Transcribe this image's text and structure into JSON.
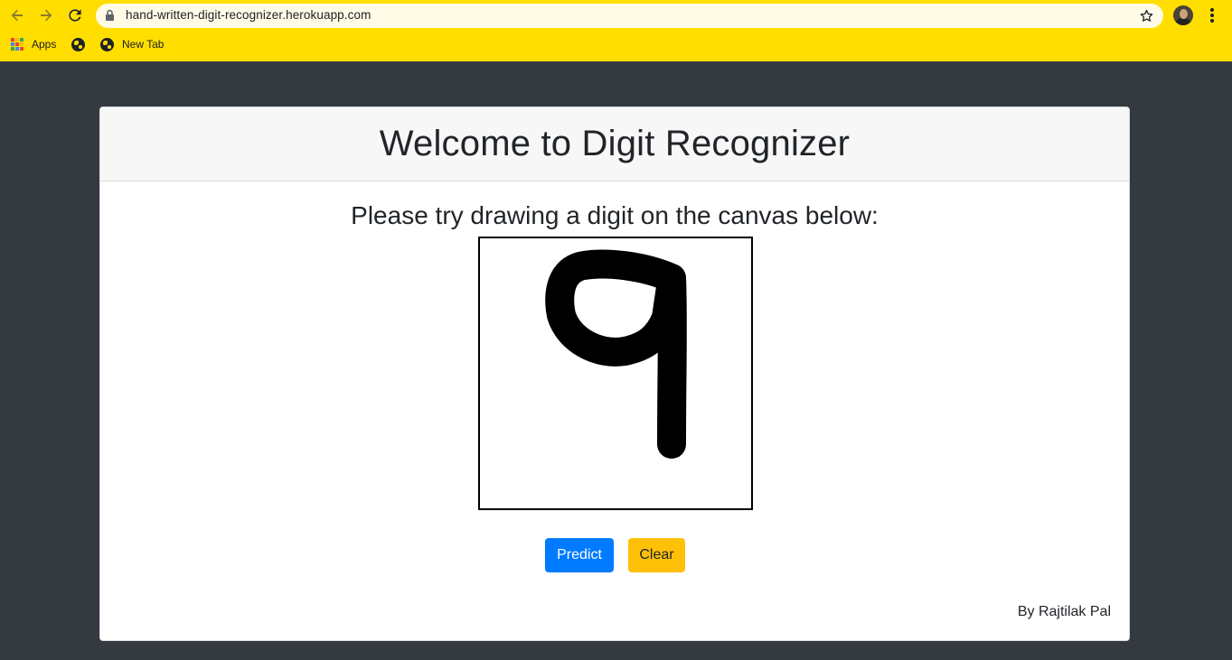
{
  "browser": {
    "url": "hand-written-digit-recognizer.herokuapp.com",
    "bookmarks": [
      {
        "label": "Apps",
        "icon": "apps-grid-icon"
      },
      {
        "label": "",
        "icon": "globe-icon"
      },
      {
        "label": "New Tab",
        "icon": "globe-icon"
      }
    ],
    "accent_color": "#ffde00"
  },
  "page": {
    "title": "Welcome to Digit Recognizer",
    "instruction": "Please try drawing a digit on the canvas below:",
    "predict_label": "Predict",
    "clear_label": "Clear",
    "author": "By Rajtilak Pal",
    "background_color": "#343a40",
    "predict_color": "#007bff",
    "clear_color": "#ffc107"
  }
}
